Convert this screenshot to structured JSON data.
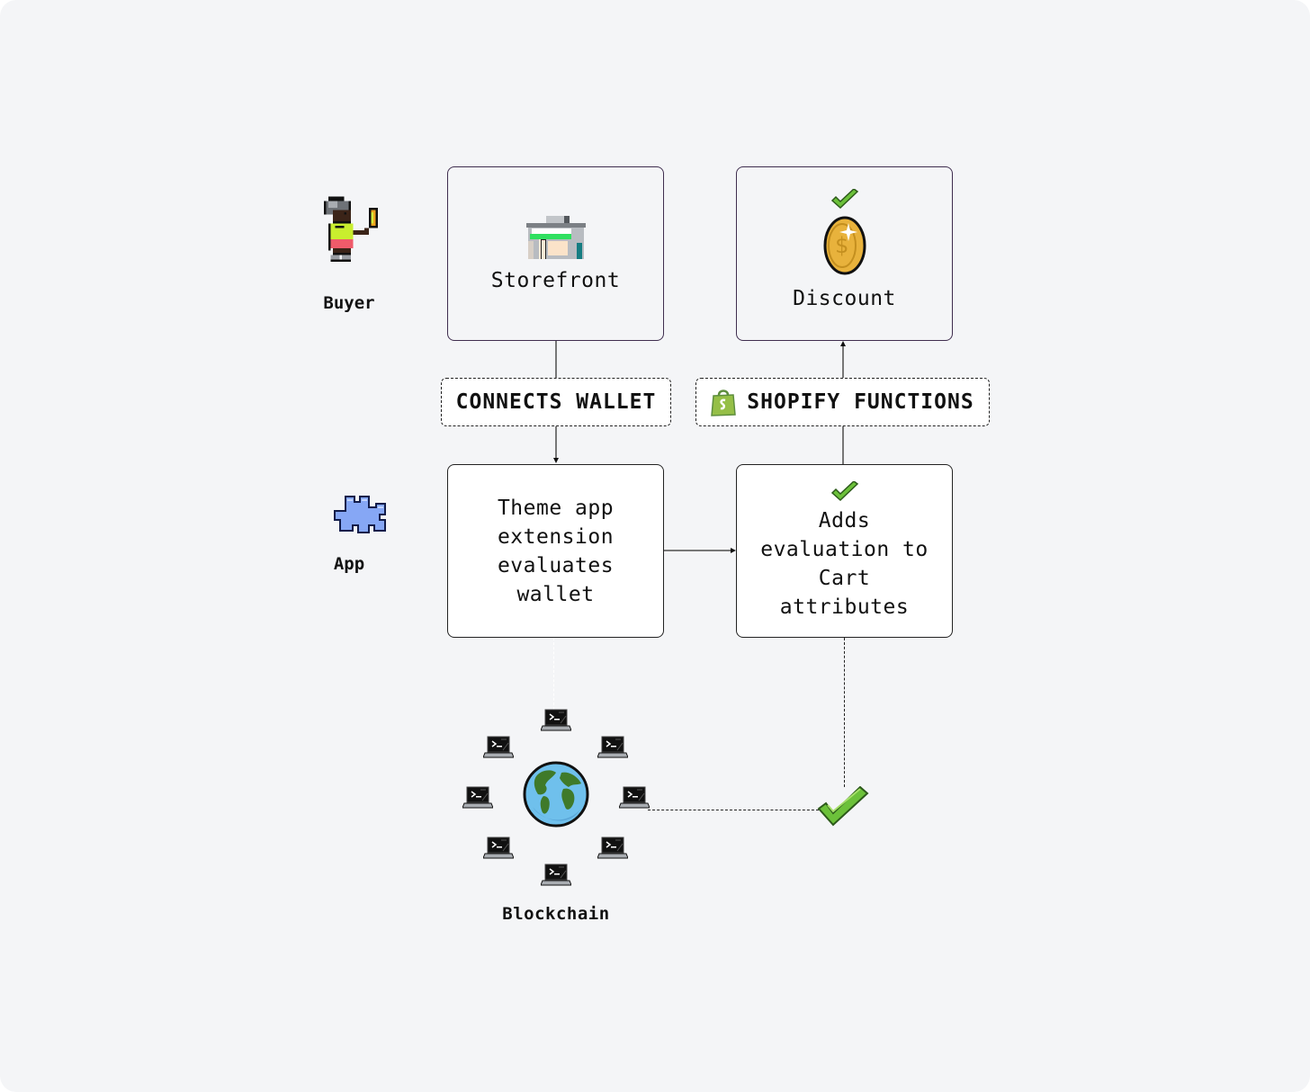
{
  "actors": {
    "buyer": {
      "label": "Buyer",
      "icon": "pixel-person-holding-coin-icon"
    },
    "app": {
      "label": "App",
      "icon": "puzzle-piece-icon"
    }
  },
  "nodes": {
    "storefront": {
      "label": "Storefront",
      "icon": "storefront-icon"
    },
    "discount": {
      "label": "Discount",
      "icon": "gold-coin-icon",
      "badge": "checkmark-icon"
    },
    "theme_extension": {
      "lines": [
        "Theme app",
        "extension",
        "evaluates",
        "wallet"
      ]
    },
    "cart_attributes": {
      "lines": [
        "Adds",
        "evaluation to",
        "Cart",
        "attributes"
      ],
      "badge": "checkmark-icon"
    }
  },
  "tags": {
    "connects_wallet": {
      "label": "CONNECTS WALLET"
    },
    "shopify_functions": {
      "label": "SHOPIFY FUNCTIONS",
      "icon": "shopify-bag-icon"
    }
  },
  "blockchain": {
    "label": "Blockchain",
    "center_icon": "globe-icon",
    "node_icon": "terminal-laptop-icon",
    "node_count": 8
  },
  "verification": {
    "icon": "checkmark-icon"
  },
  "colors": {
    "background": "#f4f5f7",
    "top_box_border": "#3f2e4f",
    "check_green": "#6cc13a",
    "shopify_green": "#95bf47",
    "puzzle_blue": "#7e9ff0",
    "coin_gold": "#e8b23c"
  }
}
